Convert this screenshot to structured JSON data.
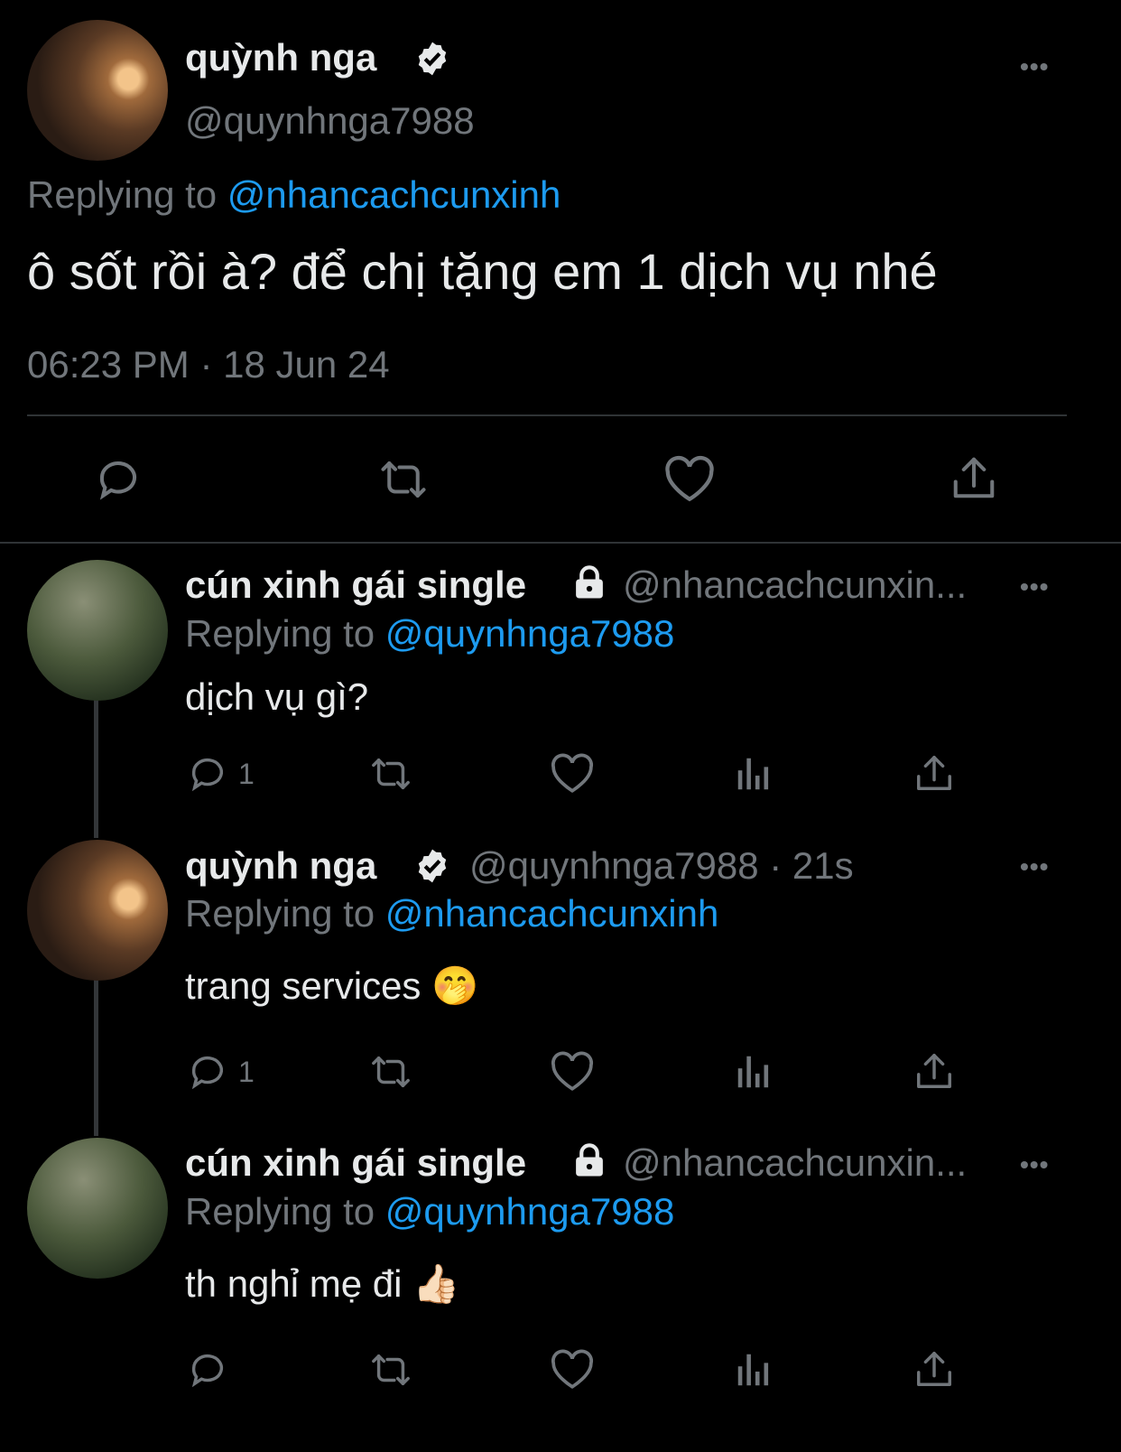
{
  "main_tweet": {
    "author_name": "quỳnh nga",
    "handle": "@quynhnga7988",
    "replying_prefix": "Replying to",
    "replying_to": "@nhancachcunxinh",
    "text": "ô sốt rồi à? để chị tặng em 1 dịch vụ nhé",
    "timestamp": "06:23 PM · 18 Jun 24",
    "verified_icon": "verified-badge-icon"
  },
  "replies": [
    {
      "author_name": "cún xinh gái single",
      "handle": "@nhancachcunxin...",
      "time": "",
      "replying_prefix": "Replying to",
      "replying_to": "@quynhnga7988",
      "text": "dịch vụ gì?",
      "reply_count": "1",
      "lock_icon": "lock-icon"
    },
    {
      "author_name": "quỳnh nga",
      "handle": "@quynhnga7988 · 21s",
      "replying_prefix": "Replying to",
      "replying_to": "@nhancachcunxinh",
      "text": "trang services 🤭",
      "reply_count": "1",
      "verified_icon": "verified-badge-icon"
    },
    {
      "author_name": "cún xinh gái single",
      "handle": "@nhancachcunxin...",
      "replying_prefix": "Replying to",
      "replying_to": "@quynhnga7988",
      "text": "th nghỉ mẹ đi 👍🏻",
      "reply_count": "",
      "lock_icon": "lock-icon"
    }
  ],
  "more_label": "•••",
  "colors": {
    "background": "#000000",
    "text": "#e7e9ea",
    "secondary": "#71767b",
    "link": "#1d9bf0",
    "divider": "#2f3336"
  }
}
